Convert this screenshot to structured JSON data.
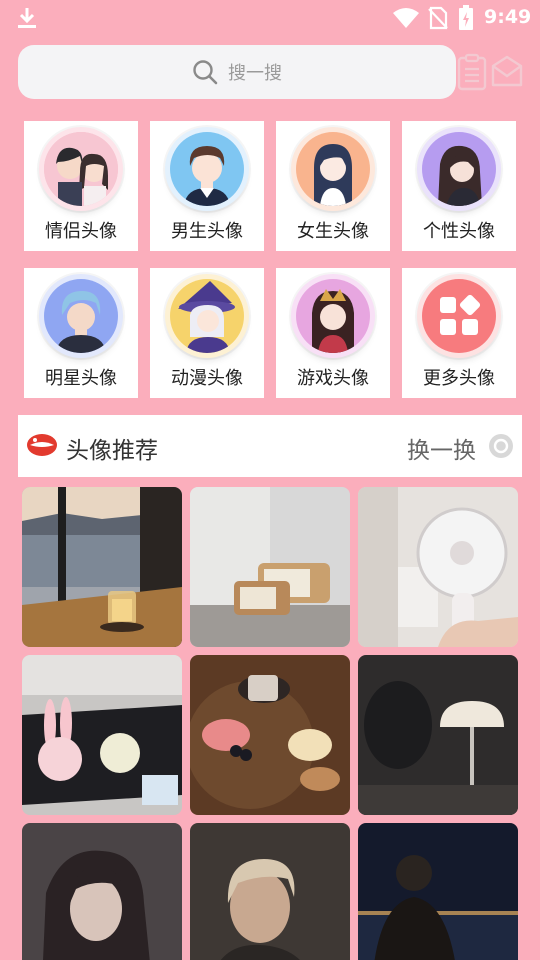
{
  "status_bar": {
    "time": "9:49"
  },
  "search": {
    "placeholder": "搜一搜"
  },
  "categories": [
    {
      "label": "情侣头像",
      "icon": "couple-avatar-icon"
    },
    {
      "label": "男生头像",
      "icon": "boy-avatar-icon"
    },
    {
      "label": "女生头像",
      "icon": "girl-avatar-icon"
    },
    {
      "label": "个性头像",
      "icon": "personality-avatar-icon"
    },
    {
      "label": "明星头像",
      "icon": "star-avatar-icon"
    },
    {
      "label": "动漫头像",
      "icon": "anime-avatar-icon"
    },
    {
      "label": "游戏头像",
      "icon": "game-avatar-icon"
    },
    {
      "label": "更多头像",
      "icon": "more-grid-icon"
    }
  ],
  "recommend": {
    "title": "头像推荐",
    "swap_label": "换一换"
  },
  "photos": [
    "lakeside-table-photo",
    "retro-tv-clock-photo",
    "hand-fan-photo",
    "bunny-bag-photo",
    "drinks-table-photo",
    "mushroom-lamp-photo",
    "girl-portrait-photo",
    "boy-portrait-photo",
    "night-portrait-photo"
  ],
  "colors": {
    "background": "#FBAEBC",
    "card": "#FFFFFF",
    "search_bg": "#F4F4F6"
  }
}
